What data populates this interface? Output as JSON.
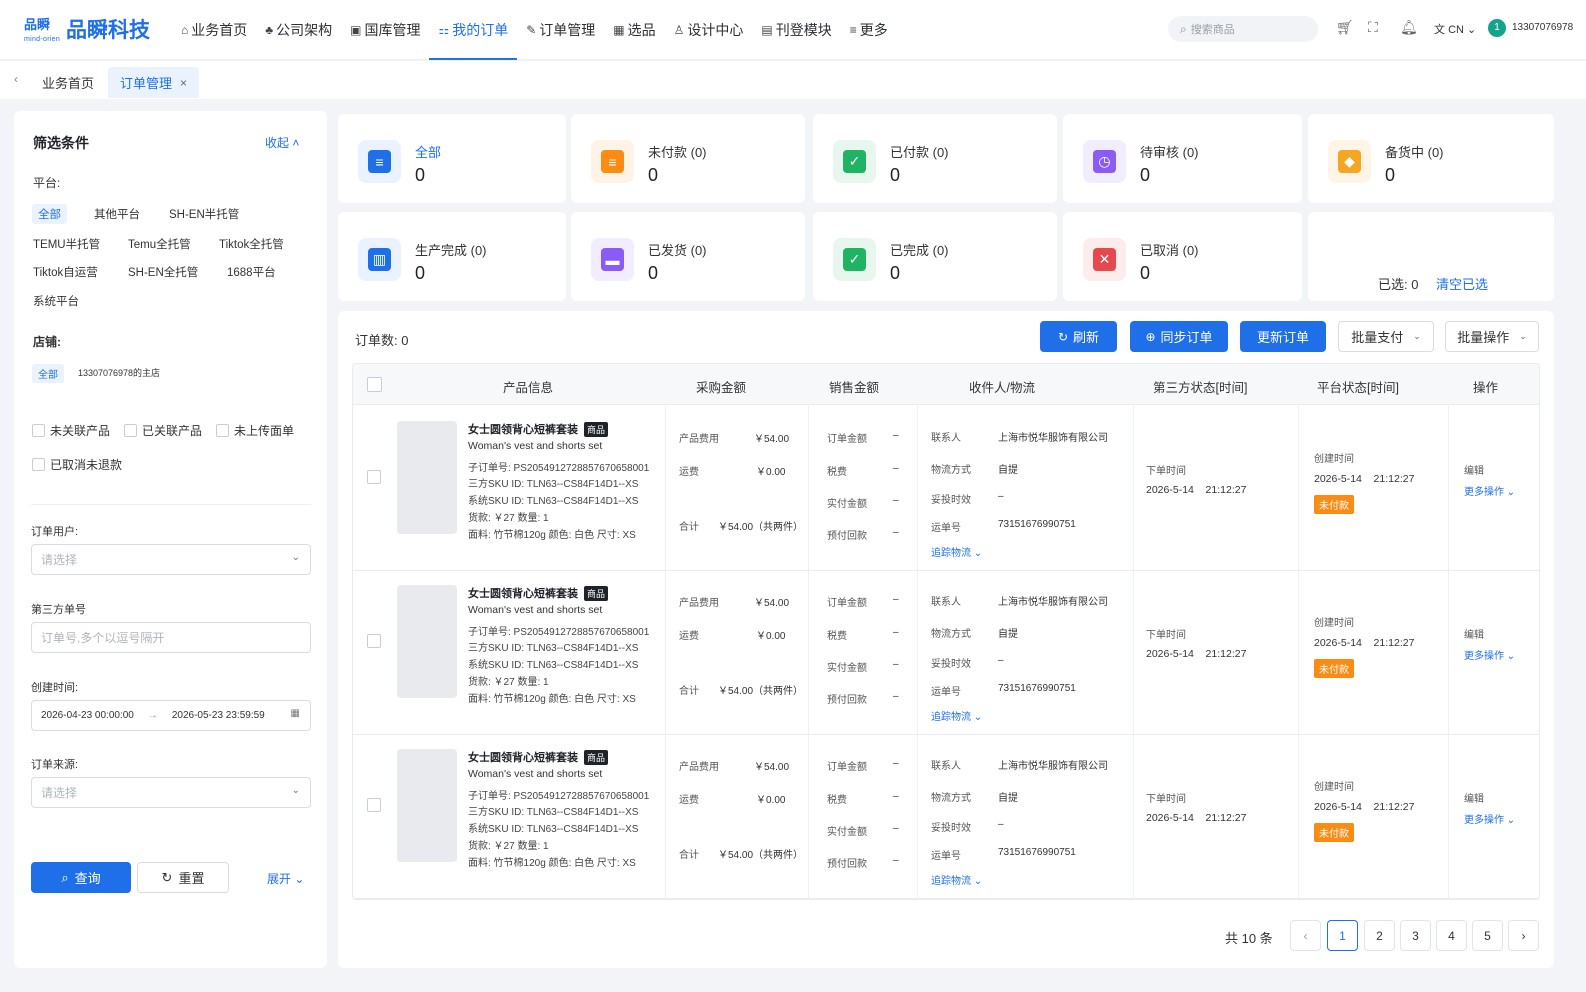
{
  "brand": {
    "logo_top": "品瞬",
    "logo_sub": "mind-orien",
    "name": "品瞬科技"
  },
  "menu": [
    {
      "icon": "⌂",
      "label": "业务首页"
    },
    {
      "icon": "♣",
      "label": "公司架构"
    },
    {
      "icon": "▣",
      "label": "国库管理"
    },
    {
      "icon": "⚏",
      "label": "我的订单"
    },
    {
      "icon": "✎",
      "label": "订单管理"
    },
    {
      "icon": "▦",
      "label": "选品"
    },
    {
      "icon": "♙",
      "label": "设计中心"
    },
    {
      "icon": "▤",
      "label": "刊登模块"
    },
    {
      "icon": "≡",
      "label": "更多"
    }
  ],
  "search": {
    "placeholder": "搜索商品"
  },
  "top": {
    "lang": "CN",
    "avatar": "1",
    "user": "13307076978"
  },
  "tabs": [
    {
      "label": "业务首页"
    },
    {
      "label": "订单管理",
      "close": "×"
    }
  ],
  "filter": {
    "title": "筛选条件",
    "collapse": "收起",
    "platform_label": "平台:",
    "platforms": [
      "全部",
      "其他平台",
      "SH-EN半托管",
      "TEMU半托管",
      "Temu全托管",
      "Tiktok全托管",
      "Tiktok自运营",
      "SH-EN全托管",
      "1688平台",
      "系统平台"
    ],
    "store_label": "店铺:",
    "stores": [
      "全部",
      "13307076978的主店"
    ],
    "checks": [
      "未关联产品",
      "已关联产品",
      "未上传面单",
      "已取消未退款"
    ],
    "user_label": "订单用户:",
    "user_placeholder": "请选择",
    "third_label": "第三方单号",
    "third_placeholder": "订单号,多个以逗号隔开",
    "created_label": "创建时间:",
    "date_start": "2026-04-23 00:00:00",
    "date_arrow": "→",
    "date_end": "2026-05-23 23:59:59",
    "source_label": "订单来源:",
    "source_placeholder": "请选择",
    "query": "查询",
    "reset": "重置",
    "expand": "展开"
  },
  "status_cards": [
    {
      "label": "全部",
      "value": "0",
      "color": "#1f6fe8",
      "bg": "#eaf2fe",
      "icon": "≡"
    },
    {
      "label": "未付款 (0)",
      "value": "0",
      "color": "#fa8c16",
      "bg": "#fff3e6",
      "icon": "≡"
    },
    {
      "label": "已付款 (0)",
      "value": "0",
      "color": "#1fb464",
      "bg": "#e8f7ee",
      "icon": "✓"
    },
    {
      "label": "待审核 (0)",
      "value": "0",
      "color": "#8a5cf5",
      "bg": "#f1ecfe",
      "icon": "◷"
    },
    {
      "label": "备货中 (0)",
      "value": "0",
      "color": "#f5a623",
      "bg": "#fff5e6",
      "icon": "◆"
    },
    {
      "label": "生产完成 (0)",
      "value": "0",
      "color": "#1f6fe8",
      "bg": "#eaf2fe",
      "icon": "▥"
    },
    {
      "label": "已发货 (0)",
      "value": "0",
      "color": "#8a5cf5",
      "bg": "#f1ecfe",
      "icon": "▬"
    },
    {
      "label": "已完成 (0)",
      "value": "0",
      "color": "#1fb464",
      "bg": "#e8f7ee",
      "icon": "✓"
    },
    {
      "label": "已取消 (0)",
      "value": "0",
      "color": "#e5484d",
      "bg": "#fdecec",
      "icon": "✕"
    }
  ],
  "selection": {
    "label": "已选: 0",
    "clear": "清空已选"
  },
  "orders": {
    "count_label": "订单数: 0",
    "buttons": {
      "refresh": "刷新",
      "sync": "同步订单",
      "update": "更新订单",
      "batch_pay": "批量支付",
      "batch_ops": "批量操作"
    },
    "columns": [
      "产品信息",
      "采购金额",
      "销售金额",
      "收件人/物流",
      "第三方状态[时间]",
      "平台状态[时间]",
      "操作"
    ],
    "rows": [
      {
        "title": "女士圆领背心短裤套装",
        "tag": "商品",
        "en": "Woman's vest and shorts set",
        "sub_order": "子订单号:  PS2054912728857670658001",
        "third_sku": "三方SKU ID:  TLN63--CS84F14D1--XS",
        "sys_sku": "系统SKU ID:  TLN63--CS84F14D1--XS",
        "price_qty": "货款:  ￥27     数量:  1",
        "attrs": "面料:  竹节棉120g    颜色:  白色    尺寸:  XS",
        "product_fee_label": "产品费用",
        "product_fee": "￥54.00",
        "freight_label": "运费",
        "freight": "￥0.00",
        "total_label": "合计",
        "total": "￥54.00（共两件）",
        "sale_labels": [
          "订单金额",
          "税费",
          "实付金额",
          "预付回款"
        ],
        "sale_values": [
          "–",
          "–",
          "–",
          "–"
        ],
        "contact_label": "联系人",
        "contact": "上海市悦华服饰有限公司",
        "ship_label": "物流方式",
        "ship": "自提",
        "sla_label": "妥投时效",
        "sla": "–",
        "track_label": "运单号",
        "track": "73151676990751",
        "ship_link": "追踪物流",
        "third_time_label": "下单时间",
        "third_time": "2026-5-14    21:12:27",
        "plat_time_label": "创建时间",
        "plat_time": "2026-5-14    21:12:27",
        "plat_status": "未付款",
        "edit": "编辑",
        "more": "更多操作"
      },
      {
        "title": "女士圆领背心短裤套装",
        "tag": "商品",
        "en": "Woman's vest and shorts set",
        "sub_order": "子订单号:  PS2054912728857670658001",
        "third_sku": "三方SKU ID:  TLN63--CS84F14D1--XS",
        "sys_sku": "系统SKU ID:  TLN63--CS84F14D1--XS",
        "price_qty": "货款:  ￥27     数量:  1",
        "attrs": "面料:  竹节棉120g    颜色:  白色    尺寸:  XS",
        "product_fee_label": "产品费用",
        "product_fee": "￥54.00",
        "freight_label": "运费",
        "freight": "￥0.00",
        "total_label": "合计",
        "total": "￥54.00（共两件）",
        "sale_labels": [
          "订单金额",
          "税费",
          "实付金额",
          "预付回款"
        ],
        "sale_values": [
          "–",
          "–",
          "–",
          "–"
        ],
        "contact_label": "联系人",
        "contact": "上海市悦华服饰有限公司",
        "ship_label": "物流方式",
        "ship": "自提",
        "sla_label": "妥投时效",
        "sla": "–",
        "track_label": "运单号",
        "track": "73151676990751",
        "ship_link": "追踪物流",
        "third_time_label": "下单时间",
        "third_time": "2026-5-14    21:12:27",
        "plat_time_label": "创建时间",
        "plat_time": "2026-5-14    21:12:27",
        "plat_status": "未付款",
        "edit": "编辑",
        "more": "更多操作"
      },
      {
        "title": "女士圆领背心短裤套装",
        "tag": "商品",
        "en": "Woman's vest and shorts set",
        "sub_order": "子订单号:  PS2054912728857670658001",
        "third_sku": "三方SKU ID:  TLN63--CS84F14D1--XS",
        "sys_sku": "系统SKU ID:  TLN63--CS84F14D1--XS",
        "price_qty": "货款:  ￥27     数量:  1",
        "attrs": "面料:  竹节棉120g    颜色:  白色    尺寸:  XS",
        "product_fee_label": "产品费用",
        "product_fee": "￥54.00",
        "freight_label": "运费",
        "freight": "￥0.00",
        "total_label": "合计",
        "total": "￥54.00（共两件）",
        "sale_labels": [
          "订单金额",
          "税费",
          "实付金额",
          "预付回款"
        ],
        "sale_values": [
          "–",
          "–",
          "–",
          "–"
        ],
        "contact_label": "联系人",
        "contact": "上海市悦华服饰有限公司",
        "ship_label": "物流方式",
        "ship": "自提",
        "sla_label": "妥投时效",
        "sla": "–",
        "track_label": "运单号",
        "track": "73151676990751",
        "ship_link": "追踪物流",
        "third_time_label": "下单时间",
        "third_time": "2026-5-14    21:12:27",
        "plat_time_label": "创建时间",
        "plat_time": "2026-5-14    21:12:27",
        "plat_status": "未付款",
        "edit": "编辑",
        "more": "更多操作"
      }
    ]
  },
  "pagination": {
    "total": "共 10 条",
    "pages": [
      "1",
      "2",
      "3",
      "4",
      "5"
    ],
    "current": "1",
    "prev": "‹",
    "next": "›"
  }
}
